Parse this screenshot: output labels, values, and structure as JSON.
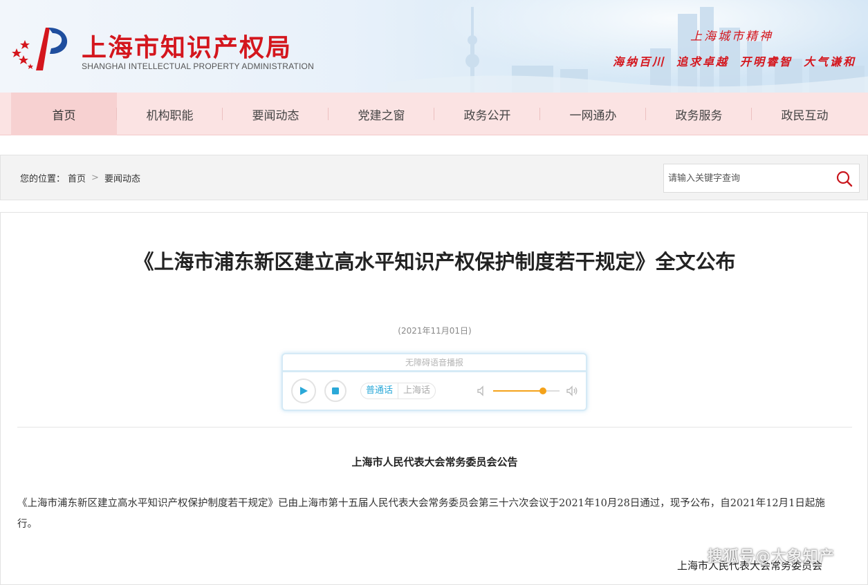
{
  "header": {
    "title": "上海市知识产权局",
    "subtitle": "SHANGHAI INTELLECTUAL PROPERTY ADMINISTRATION",
    "spirit_title": "上海城市精神",
    "spirit_words": [
      "海纳百川",
      "追求卓越",
      "开明睿智",
      "大气谦和"
    ]
  },
  "nav": {
    "items": [
      {
        "label": "首页"
      },
      {
        "label": "机构职能"
      },
      {
        "label": "要闻动态"
      },
      {
        "label": "党建之窗"
      },
      {
        "label": "政务公开"
      },
      {
        "label": "一网通办"
      },
      {
        "label": "政务服务"
      },
      {
        "label": "政民互动"
      }
    ]
  },
  "breadcrumb": {
    "prefix": "您的位置：",
    "items": [
      "首页",
      "要闻动态"
    ],
    "separator": ">"
  },
  "search": {
    "placeholder": "请输入关键字查询"
  },
  "article": {
    "title": "《上海市浦东新区建立高水平知识产权保护制度若干规定》全文公布",
    "date": "(2021年11月01日)",
    "notice_title": "上海市人民代表大会常务委员会公告",
    "body": "《上海市浦东新区建立高水平知识产权保护制度若干规定》已由上海市第十五届人民代表大会常务委员会第三十六次会议于2021年10月28日通过，现予公布，自2021年12月1日起施行。",
    "signature": "上海市人民代表大会常务委员会"
  },
  "player": {
    "header": "无障碍语音播报",
    "languages": [
      "普通话",
      "上海话"
    ],
    "selected_language": "普通话",
    "volume": 0.75,
    "accent_color": "#f4a21a"
  },
  "watermark": "搜狐号@大象知产",
  "colors": {
    "brand_red": "#d4161d",
    "nav_bg": "#fbe3e3",
    "nav_active": "#f7d1d1"
  }
}
